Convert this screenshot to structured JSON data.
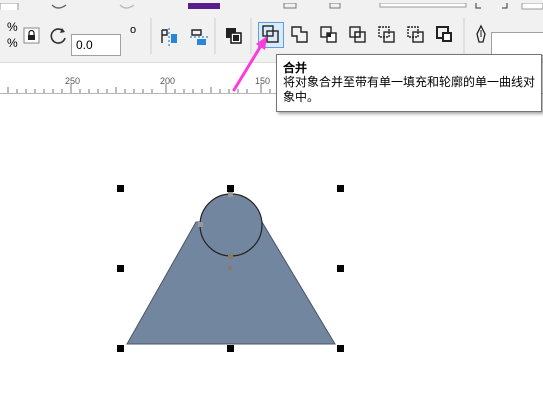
{
  "toolbar": {
    "percent_top": "%",
    "percent_bottom": "%",
    "rotation": {
      "value": "0.0",
      "degree_symbol": "o"
    }
  },
  "ruler": {
    "labels": [
      "250",
      "200",
      "150"
    ]
  },
  "tooltip": {
    "title": "合并",
    "description": "将对象合并至带有单一填充和轮廓的单一曲线对象中。"
  },
  "colors": {
    "shape_fill": "#7386a0",
    "arrow": "#ff3bd9",
    "icon_blue": "#2a86d6",
    "toolbar_bg": "#f1f1f1",
    "purple_accent": "#5a1d8c"
  },
  "icons": [
    "lock-icon",
    "rotate-icon",
    "mirror-horizontal-icon",
    "mirror-vertical-icon",
    "group-icon",
    "combine-icon",
    "weld-icon",
    "trim-icon",
    "intersect-icon",
    "simplify-icon",
    "front-minus-back-icon",
    "back-minus-front-icon",
    "boundary-icon",
    "pen-outline-icon"
  ]
}
